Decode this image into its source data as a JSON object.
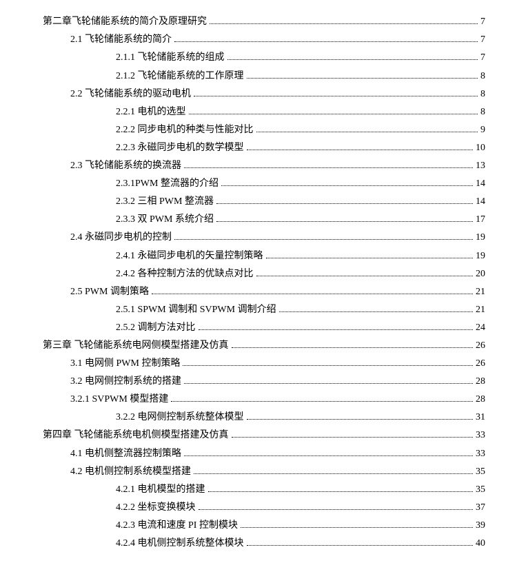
{
  "toc": [
    {
      "level": 0,
      "text": "第二章飞轮储能系统的简介及原理研究",
      "page": "7"
    },
    {
      "level": 1,
      "text": "2.1 飞轮储能系统的简介",
      "page": "7"
    },
    {
      "level": 2,
      "text": "2.1.1 飞轮储能系统的组成",
      "page": "7"
    },
    {
      "level": 2,
      "text": "2.1.2 飞轮储能系统的工作原理",
      "page": "8"
    },
    {
      "level": 1,
      "text": "2.2 飞轮储能系统的驱动电机",
      "page": " 8"
    },
    {
      "level": 2,
      "text": "2.2.1 电机的选型",
      "page": "8"
    },
    {
      "level": 2,
      "text": "2.2.2 同步电机的种类与性能对比",
      "page": "9"
    },
    {
      "level": 2,
      "text": "2.2.3 永磁同步电机的数学模型",
      "page": "10"
    },
    {
      "level": 1,
      "text": "2.3 飞轮储能系统的换流器",
      "page": "13"
    },
    {
      "level": 2,
      "text": "2.3.1PWM 整流器的介绍",
      "page": " 14"
    },
    {
      "level": 2,
      "text": "2.3.2 三相 PWM 整流器",
      "page": "14"
    },
    {
      "level": 2,
      "text": "2.3.3 双 PWM 系统介绍",
      "page": "17"
    },
    {
      "level": 1,
      "text": "2.4 永磁同步电机的控制",
      "page": "19"
    },
    {
      "level": 2,
      "text": "2.4.1 永磁同步电机的矢量控制策略",
      "page": " 19"
    },
    {
      "level": 2,
      "text": "2.4.2 各种控制方法的优缺点对比",
      "page": "20"
    },
    {
      "level": 1,
      "text": "2.5 PWM 调制策略",
      "page": " 21"
    },
    {
      "level": 2,
      "text": "2.5.1 SPWM 调制和 SVPWM 调制介绍",
      "page": " 21"
    },
    {
      "level": 2,
      "text": "2.5.2 调制方法对比",
      "page": " 24"
    },
    {
      "level": 0,
      "text": "第三章  飞轮储能系统电网侧模型搭建及仿真",
      "page": " 26"
    },
    {
      "level": 1,
      "text": "3.1 电网侧 PWM 控制策略",
      "page": "26"
    },
    {
      "level": 1,
      "text": "3.2 电网侧控制系统的搭建",
      "page": "28"
    },
    {
      "level": 1,
      "text": "3.2.1 SVPWM 模型搭建",
      "page": "28"
    },
    {
      "level": 2,
      "text": "3.2.2 电网侧控制系统整体模型",
      "page": "31"
    },
    {
      "level": 0,
      "text": "第四章 飞轮储能系统电机侧模型搭建及仿真",
      "page": " 33"
    },
    {
      "level": 1,
      "text": "4.1 电机侧整流器控制策略",
      "page": "33"
    },
    {
      "level": 1,
      "text": "4.2 电机侧控制系统模型搭建",
      "page": "35"
    },
    {
      "level": 2,
      "text": "4.2.1 电机模型的搭建",
      "page": "35"
    },
    {
      "level": 2,
      "text": "4.2.2 坐标变换模块",
      "page": "37"
    },
    {
      "level": 2,
      "text": "4.2.3 电流和速度 PI 控制模块",
      "page": "39"
    },
    {
      "level": 2,
      "text": "4.2.4 电机侧控制系统整体模块",
      "page": "40"
    }
  ]
}
